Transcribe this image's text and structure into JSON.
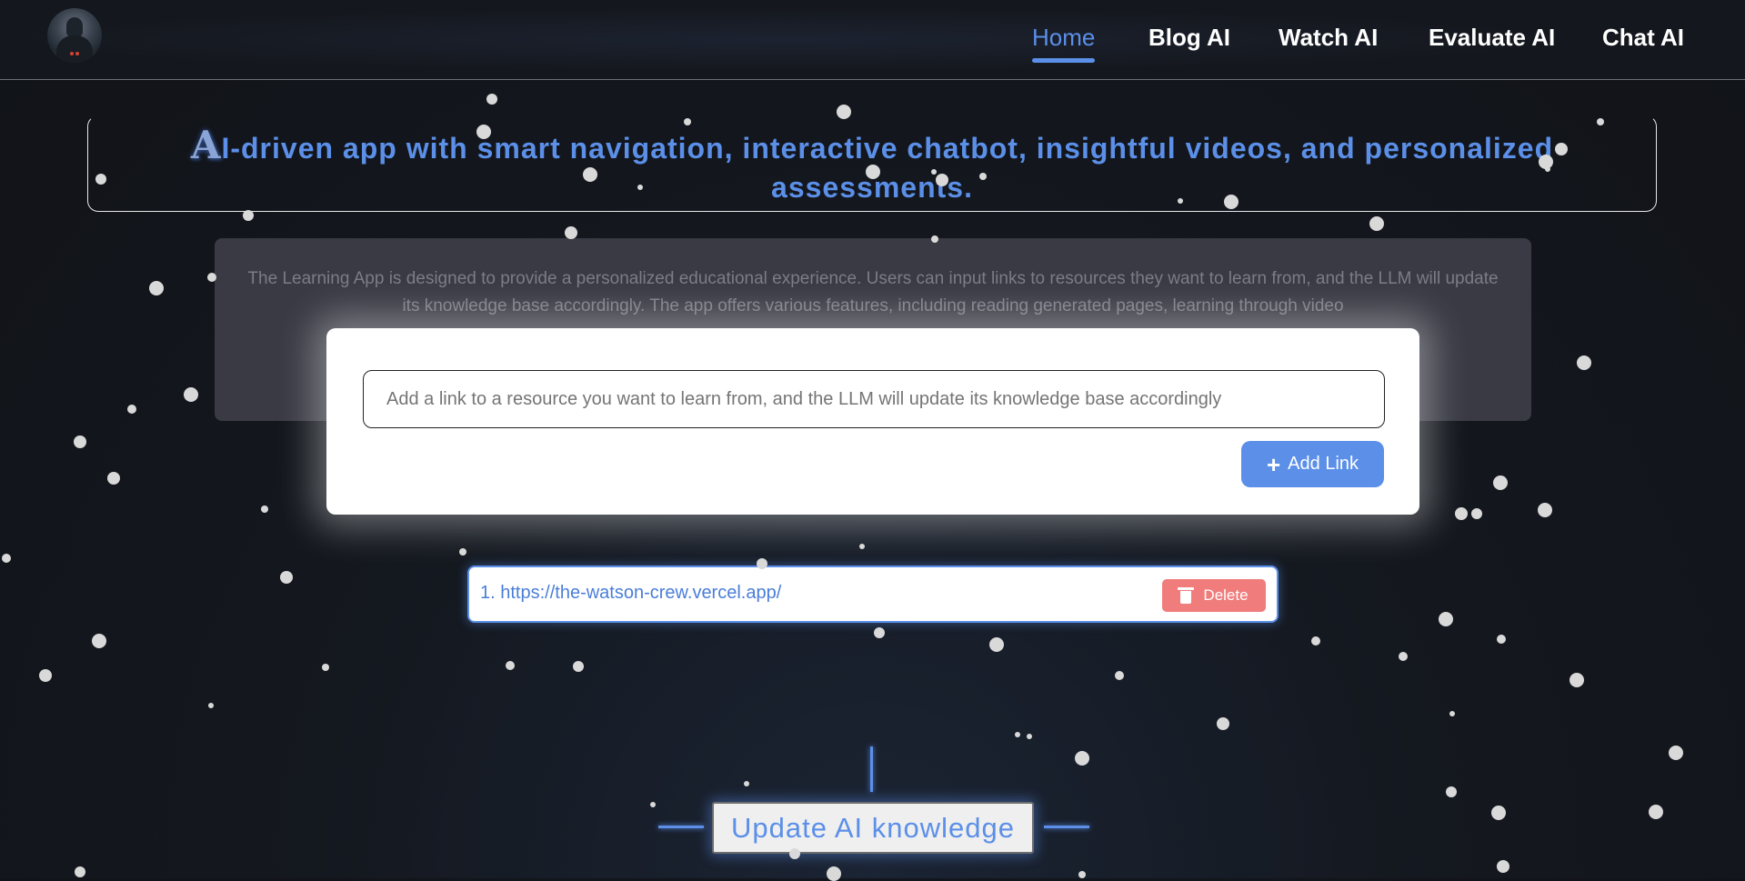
{
  "header": {
    "avatar_icon": "robot-avatar-icon",
    "nav": [
      {
        "label": "Home",
        "active": true
      },
      {
        "label": "Blog AI",
        "active": false
      },
      {
        "label": "Watch AI",
        "active": false
      },
      {
        "label": "Evaluate AI",
        "active": false
      },
      {
        "label": "Chat AI",
        "active": false
      }
    ]
  },
  "hero": {
    "first_letter": "A",
    "title_rest": "I-driven app with smart navigation, interactive chatbot, insightful videos, and personalized assessments."
  },
  "description": "The Learning App is designed to provide a personalized educational experience. Users can input links to resources they want to learn from, and the LLM will update its knowledge base accordingly. The app offers various features, including reading generated pages, learning through video",
  "add_link": {
    "placeholder": "Add a link to a resource you want to learn from, and the LLM will update its knowledge base accordingly",
    "value": "",
    "button_label": "Add Link",
    "button_icon": "plus-icon"
  },
  "links": [
    {
      "text": "1. https://the-watson-crew.vercel.app/",
      "delete_label": "Delete",
      "delete_icon": "trash-icon"
    }
  ],
  "update_button_label": "Update AI knowledge",
  "colors": {
    "accent": "#5b8fe8",
    "delete": "#f07c7c",
    "background": "#14171d",
    "panel": "#393a44"
  }
}
